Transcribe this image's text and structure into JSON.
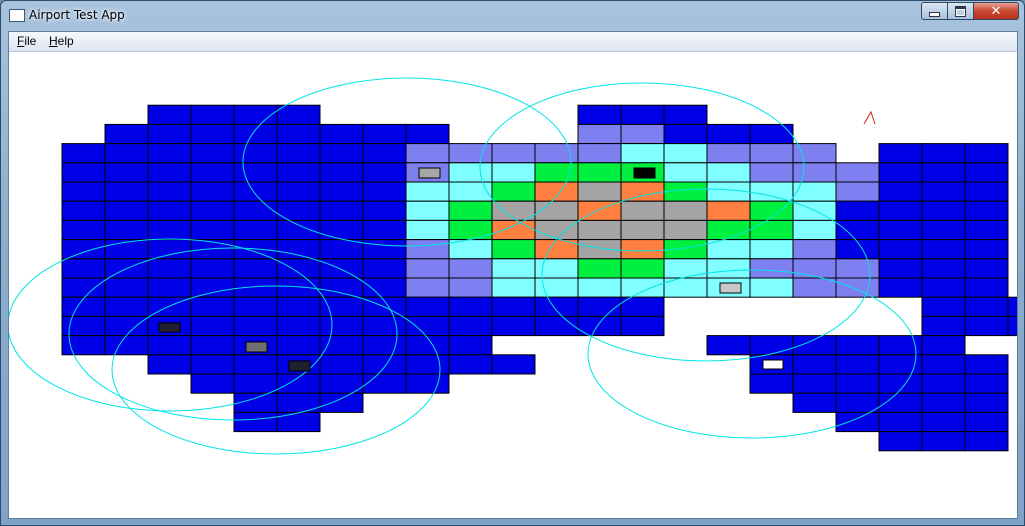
{
  "window": {
    "title": "Airport Test App",
    "controls": [
      "minimize",
      "maximize",
      "close"
    ]
  },
  "menu": {
    "items": [
      {
        "label": "File",
        "mnemonic": "F",
        "rest": "ile"
      },
      {
        "label": "Help",
        "mnemonic": "H",
        "rest": "elp"
      }
    ]
  },
  "colors": {
    "grid_line": "#000000",
    "ring": "#00e5e5",
    "outer": "#0000e6",
    "level": {
      "0": "#0000e6",
      "1": "#7e7ff0",
      "2": "#7fffff",
      "3": "#00f040",
      "4": "#ff8040",
      "5": "#a4a4a4"
    }
  },
  "heatmap": {
    "cols": 21,
    "rows": 19,
    "rows_data": [
      ".......................",
      "..0000......000........",
      ".00000000...11000......",
      "000000001111122111.000.",
      "0000000012233322111000.",
      "0000000022345432221000.",
      "0000000023554554320000.",
      "0000000023455553320000.",
      "0000000012345432210000.",
      "0000000011223322111000.",
      "0000000011222222211000.",
      "00000000000000......000",
      "00000000000000......000",
      "0000000000.....000000..",
      "..000000000.....000000.",
      "...000000.......000000.",
      "....000..........00000.",
      "....00............0000.",
      "...................000."
    ]
  },
  "aircraft": [
    {
      "name": "aircraft-1",
      "fill": "#a6a6a6"
    },
    {
      "name": "aircraft-2",
      "fill": "#000000"
    },
    {
      "name": "aircraft-3",
      "fill": "#c8c8c8"
    },
    {
      "name": "aircraft-4",
      "fill": "#ffffff"
    },
    {
      "name": "aircraft-5",
      "fill": "#202030"
    },
    {
      "name": "aircraft-6",
      "fill": "#707070"
    },
    {
      "name": "aircraft-7",
      "fill": "#202030"
    }
  ]
}
